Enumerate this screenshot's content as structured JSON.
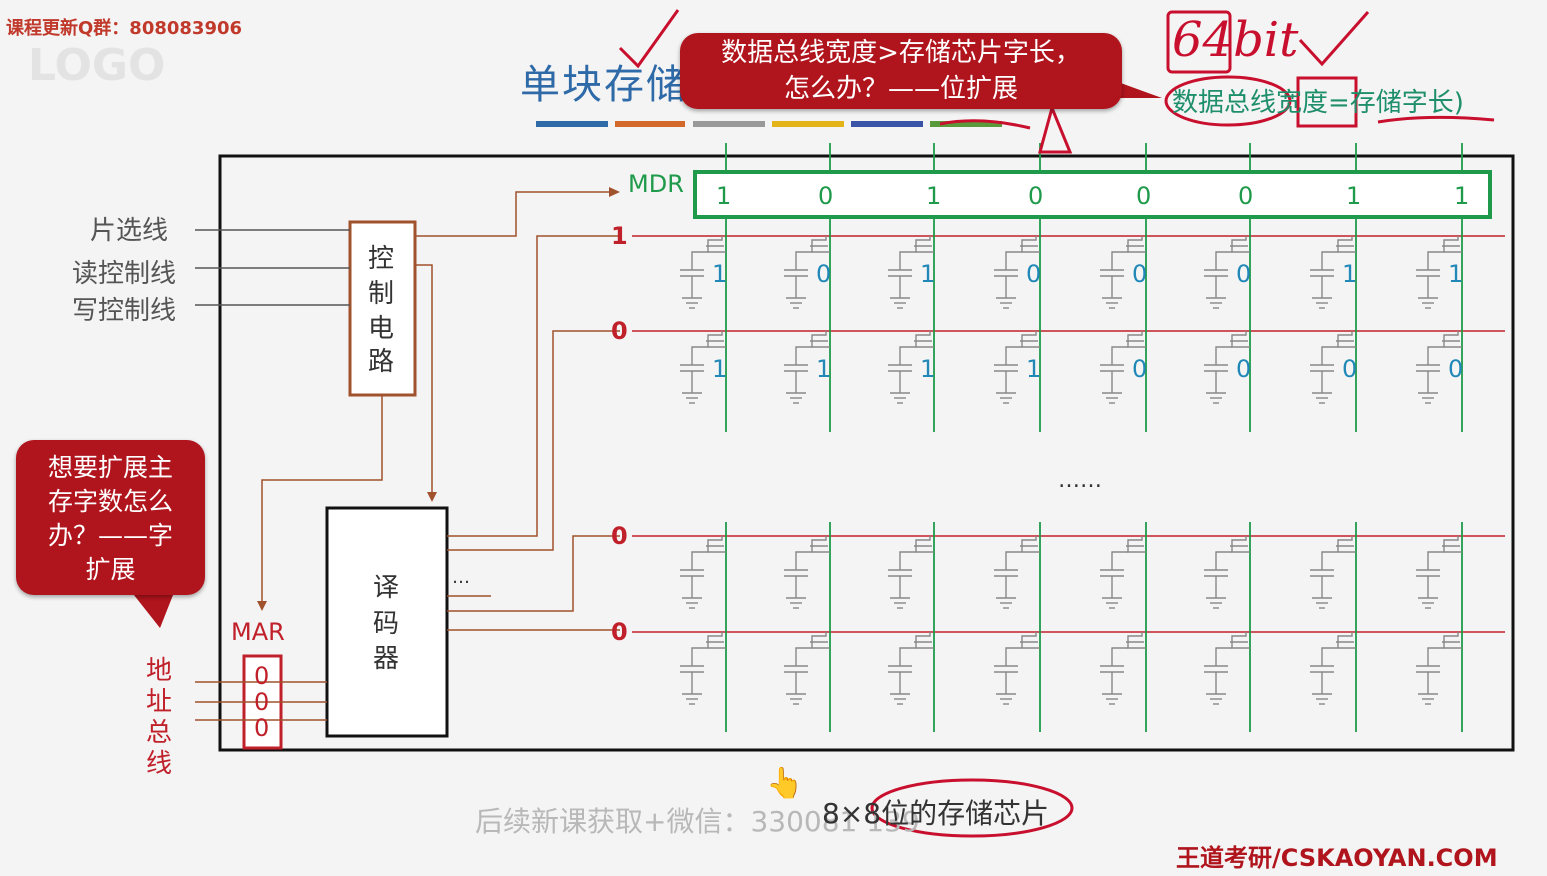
{
  "watermark_top": "课程更新Q群：808083906",
  "slide_title": "单块存储",
  "callout_top": {
    "line1": "数据总线宽度>存储芯片字长，",
    "line2": "怎么办？——位扩展"
  },
  "handwritten_note": "64bit",
  "bus_note": "数据总线宽度=存储字长)",
  "callout_left": {
    "line1": "想要扩展主",
    "line2": "存字数怎么",
    "line3": "办？——字",
    "line4": "扩展"
  },
  "signals": {
    "chip_select": "片选线",
    "read_control": "读控制线",
    "write_control": "写控制线"
  },
  "control_circuit": [
    "控",
    "制",
    "电",
    "路"
  ],
  "decoder": [
    "译",
    "码",
    "器"
  ],
  "decoder_dots": "…",
  "mdr_label": "MDR",
  "mdr_bits": [
    "1",
    "0",
    "1",
    "0",
    "0",
    "0",
    "1",
    "1"
  ],
  "row_select": [
    "1",
    "0",
    "0",
    "0"
  ],
  "cell_bits": [
    [
      "1",
      "0",
      "1",
      "0",
      "0",
      "0",
      "1",
      "1"
    ],
    [
      "1",
      "1",
      "1",
      "1",
      "0",
      "0",
      "0",
      "0"
    ]
  ],
  "ellipsis": "……",
  "mar_label": "MAR",
  "mar_bits": [
    "0",
    "0",
    "0"
  ],
  "address_bus": [
    "地",
    "址",
    "总",
    "线"
  ],
  "bottom_watermark": "后续新课获取+微信：330081 139",
  "chip_description": "8×8位的存储芯片",
  "brand": "王道考研/CSKAOYAN.COM",
  "colors": {
    "accent_red": "#b0141c",
    "mdr_green": "#1e9a4a",
    "bit_blue": "#2288b8",
    "title_blue": "#2f6aa8"
  }
}
